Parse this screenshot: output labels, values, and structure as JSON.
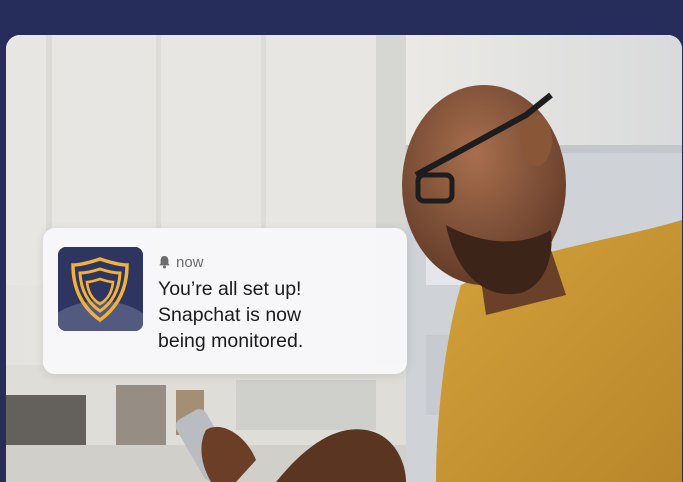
{
  "notification": {
    "time": "now",
    "lines": [
      "You’re all set up!",
      "Snapchat is now",
      "being monitored."
    ],
    "app_icon": "shield-logo-icon",
    "time_icon": "bell-icon"
  },
  "colors": {
    "page_background": "#262d5a",
    "icon_background": "#2e3561",
    "icon_accent": "#f0b23c",
    "shirt": "#c8952f"
  }
}
